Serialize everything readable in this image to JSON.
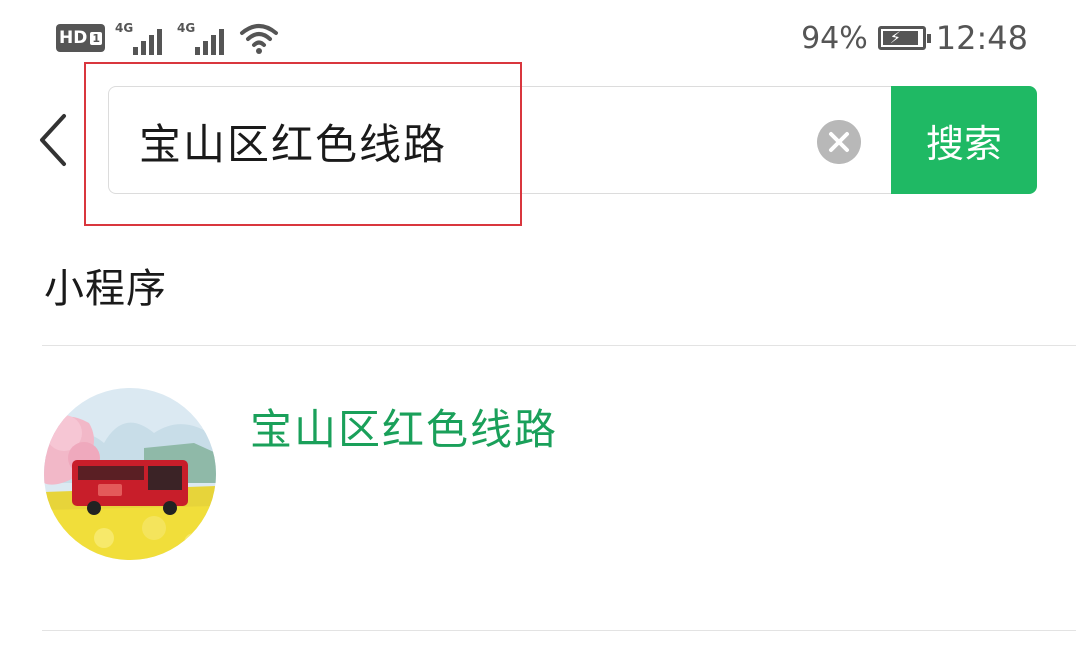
{
  "status_bar": {
    "hd_label": "HD",
    "hd_sub": "1",
    "network": [
      "4G",
      "4G"
    ],
    "wifi_icon": "wifi-icon",
    "battery_percent": "94%",
    "battery_level": 0.94,
    "battery_icon": "battery-charging-icon",
    "time": "12:48"
  },
  "search": {
    "query": "宝山区红色线路",
    "submit_label": "搜索",
    "clear_icon": "clear-icon",
    "back_icon": "chevron-left-icon"
  },
  "colors": {
    "accent": "#1fb964",
    "result_title": "#1aa05a",
    "highlight": "#d9363e"
  },
  "section": {
    "title": "小程序"
  },
  "results": [
    {
      "title": "宝山区红色线路",
      "icon": "red-bus-mini-program-icon"
    }
  ]
}
